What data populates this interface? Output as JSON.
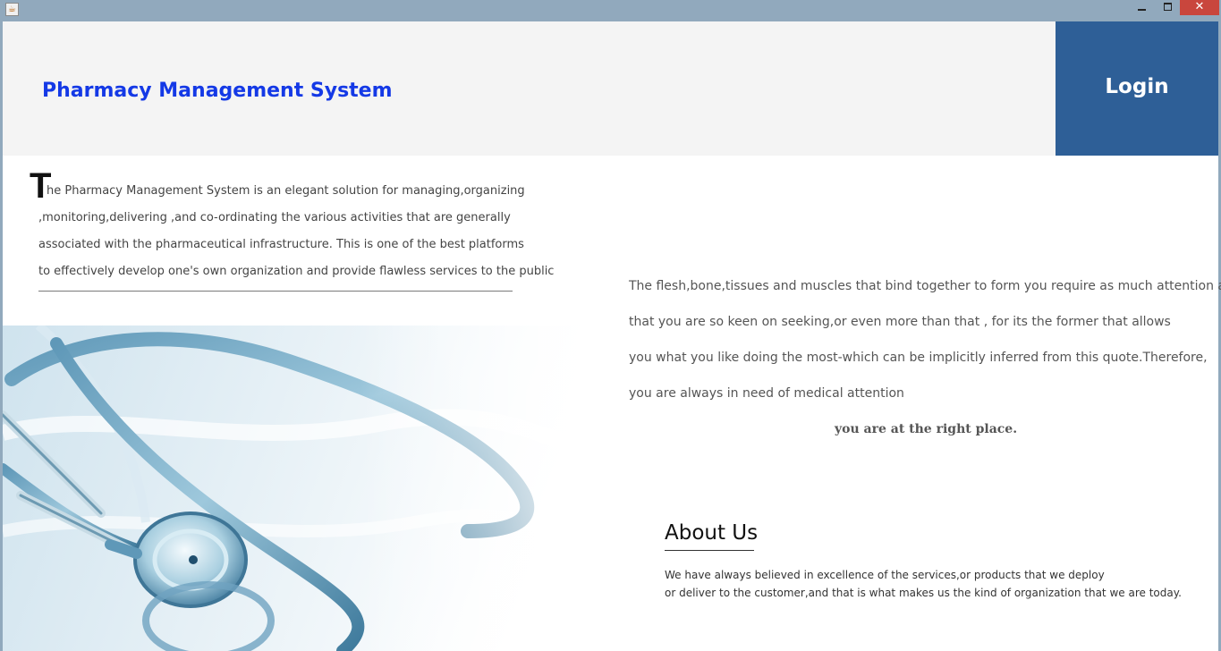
{
  "window": {
    "app_icon_glyph": "☕",
    "minimize_label": "",
    "maximize_label": "",
    "close_label": "✕"
  },
  "header": {
    "title": "Pharmacy Management System",
    "login_label": "Login",
    "colors": {
      "title": "#1439e6",
      "login_bg": "#2e5f97",
      "header_bg": "#f4f4f4"
    }
  },
  "intro": {
    "drop_cap": "T",
    "lines": [
      "he Pharmacy Management System is an elegant solution for managing,organizing",
      ",monitoring,delivering ,and co-ordinating the various activities that are generally",
      "associated with the pharmaceutical infrastructure. This is one of the best platforms",
      "to effectively develop one's own organization and provide flawless services to the public"
    ]
  },
  "hero_image": {
    "icon": "stethoscope-image"
  },
  "quote": {
    "lines": [
      "The flesh,bone,tissues and muscles that bind together to form you require as much attention as",
      "that you are so keen on seeking,or even more than that , for its the former that allows",
      "you what you like doing the most-which can be implicitly inferred from this quote.Therefore,",
      "you are always in need of medical attention"
    ],
    "emphasis": "you are at the right place."
  },
  "about": {
    "title": "About Us",
    "lines": [
      "We have always believed in excellence of the services,or products that we deploy",
      "or deliver to the customer,and that is what makes us the kind of organization that we are today."
    ]
  }
}
